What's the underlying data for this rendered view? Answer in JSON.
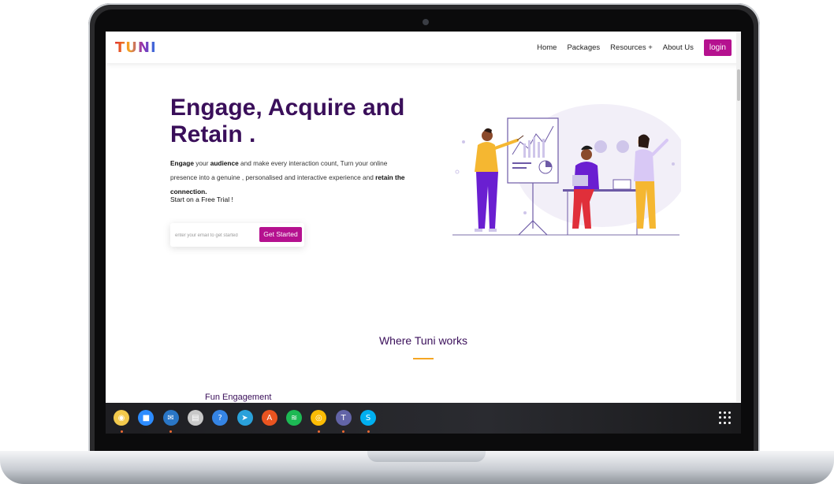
{
  "logo": "TUNI",
  "nav": {
    "items": [
      "Home",
      "Packages",
      "Resources +",
      "About Us"
    ],
    "login": "login"
  },
  "hero": {
    "title": "Engage, Acquire and Retain .",
    "text_parts": [
      {
        "t": "Engage",
        "bold": true
      },
      {
        "t": " your ",
        "bold": false
      },
      {
        "t": "audience",
        "bold": true
      },
      {
        "t": " and make every interaction count, Turn your online presence into a genuine , personalised and interactive experience and ",
        "bold": false
      },
      {
        "t": "retain the connection.",
        "bold": true
      }
    ],
    "trial_text": "Start on a Free Trial !",
    "email_placeholder": "enter your email to get started",
    "cta_label": "Get Started"
  },
  "section": {
    "title": "Where Tuni works",
    "subtitle": "Fun Engagement"
  },
  "taskbar": {
    "apps": [
      {
        "name": "rhythmbox-icon",
        "color": "#f2c94c",
        "glyph": "◉",
        "running": true
      },
      {
        "name": "zoom-icon",
        "color": "#2d8cff",
        "glyph": "■",
        "running": false
      },
      {
        "name": "thunderbird-icon",
        "color": "#2a76c6",
        "glyph": "✉",
        "running": true
      },
      {
        "name": "files-icon",
        "color": "#c8c8c8",
        "glyph": "▤",
        "running": false
      },
      {
        "name": "help-icon",
        "color": "#3584e4",
        "glyph": "?",
        "running": false
      },
      {
        "name": "telegram-icon",
        "color": "#2aa1da",
        "glyph": "➤",
        "running": false
      },
      {
        "name": "app-center-icon",
        "color": "#e95420",
        "glyph": "A",
        "running": false
      },
      {
        "name": "spotify-icon",
        "color": "#1db954",
        "glyph": "≋",
        "running": false
      },
      {
        "name": "chrome-icon",
        "color": "#fbbc05",
        "glyph": "◎",
        "running": true
      },
      {
        "name": "teams-icon",
        "color": "#6264a7",
        "glyph": "T",
        "running": true
      },
      {
        "name": "skype-icon",
        "color": "#00aff0",
        "glyph": "S",
        "running": true
      }
    ]
  },
  "colors": {
    "brand_purple": "#3a0f5a",
    "button_magenta": "#b5118f",
    "accent_orange": "#f5a623"
  }
}
